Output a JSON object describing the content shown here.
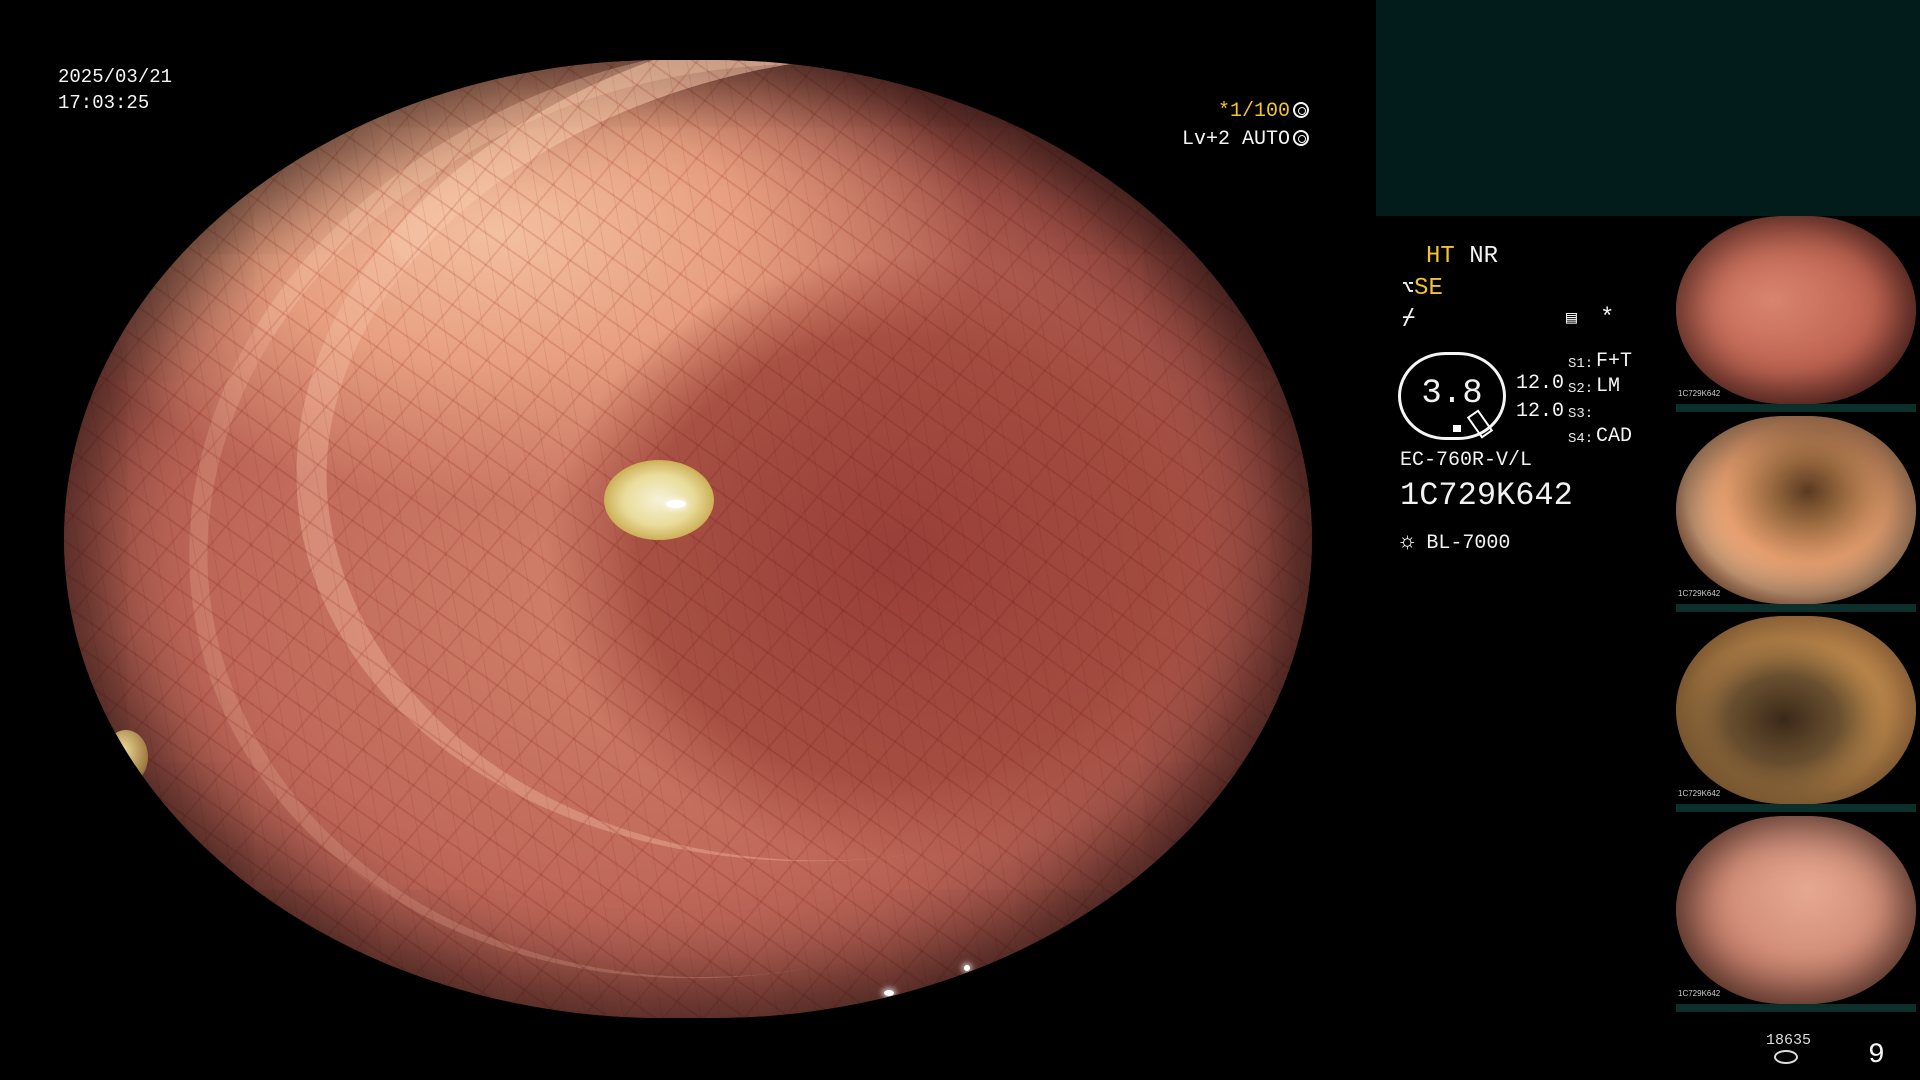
{
  "overlay": {
    "date": "2025/03/21",
    "time": "17:03:25",
    "shutter_prefix": "*",
    "shutter_value": "1/100",
    "shutter_icon": "aperture-icon",
    "level": "Lv+2 AUTO",
    "level_icon": "auto-iris-icon"
  },
  "status": {
    "ht": "HT",
    "nr": "NR",
    "se": "SE",
    "se_icon": "enhance-icon",
    "flash_icon": "freeze-icon",
    "record_icon": "memory-icon",
    "asterisk": "*",
    "scale_value": "3.8",
    "left_values": [
      "12.0",
      "12.0"
    ],
    "s_items": [
      {
        "label": "S1:",
        "value": "F+T"
      },
      {
        "label": "S2:",
        "value": "LM"
      },
      {
        "label": "S3:",
        "value": ""
      },
      {
        "label": "S4:",
        "value": "CAD"
      }
    ],
    "scope_model": "EC-760R-V/L",
    "scope_serial": "1C729K642",
    "light_source_icon": "lamp-icon",
    "light_source": "BL-7000"
  },
  "thumbnails": [
    {
      "name": "thumbnail-1",
      "caption": "1C729K642"
    },
    {
      "name": "thumbnail-2",
      "caption": "1C729K642"
    },
    {
      "name": "thumbnail-3",
      "caption": "1C729K642"
    },
    {
      "name": "thumbnail-4",
      "caption": "1C729K642"
    }
  ],
  "counter": {
    "small": "18635",
    "big": "9",
    "icon": "storage-icon"
  },
  "colors": {
    "accent_yellow": "#f2c230",
    "panel_teal": "#021c1c",
    "text": "#f5f5f5"
  }
}
